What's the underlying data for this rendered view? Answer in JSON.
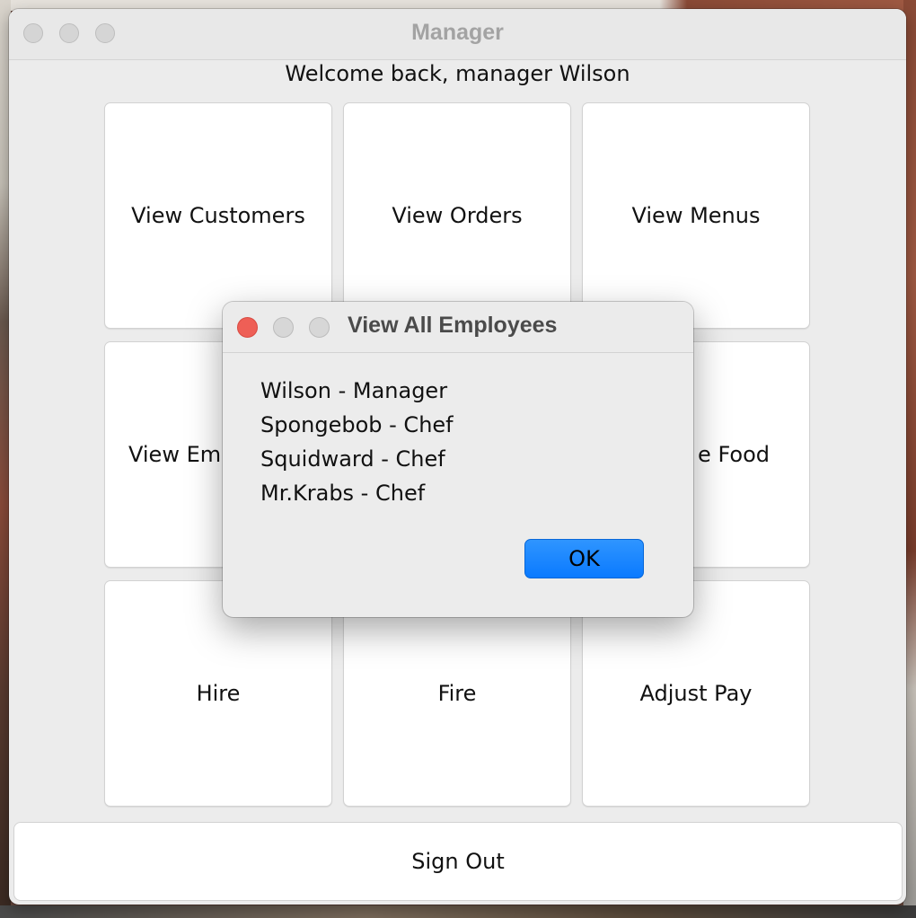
{
  "window": {
    "title": "Manager",
    "welcome": "Welcome back, manager Wilson"
  },
  "grid": {
    "view_customers": "View Customers",
    "view_orders": "View Orders",
    "view_menus": "View Menus",
    "view_employees_partial": "View Em",
    "food_partial": "e Food",
    "hire": "Hire",
    "fire": "Fire",
    "adjust_pay": "Adjust Pay"
  },
  "sign_out": "Sign Out",
  "dialog": {
    "title": "View All Employees",
    "employees": [
      "Wilson - Manager",
      "Spongebob - Chef",
      "Squidward - Chef",
      "Mr.Krabs - Chef"
    ],
    "ok_label": "OK"
  },
  "colors": {
    "accent": "#0a7aff",
    "close": "#ee5f56",
    "window_bg": "#ececec"
  }
}
